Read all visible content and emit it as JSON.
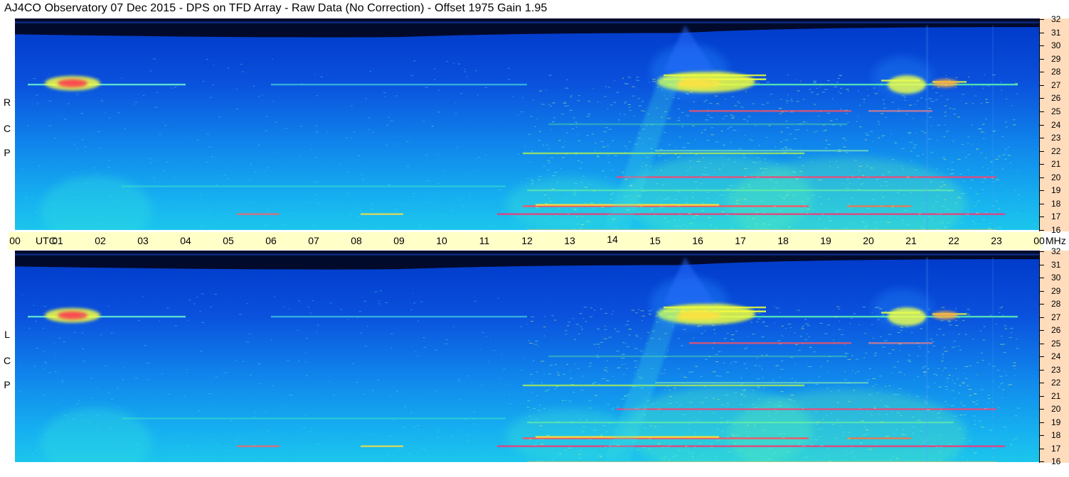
{
  "title": "AJ4CO Observatory  07 Dec 2015  -  DPS on TFD Array  -  Raw Data (No Correction)  -  Offset 1975  Gain 1.95",
  "colors": {
    "timebar": "#ffffc8",
    "freqscale": "#ffdcbc",
    "low": "#0a2db4",
    "high": "#ff3040"
  },
  "chart_data": [
    {
      "type": "heatmap",
      "panel": "RCP",
      "side_label": [
        "R",
        "C",
        "P"
      ],
      "x_unit": "UTC",
      "x_ticks": [
        "00",
        "01",
        "02",
        "03",
        "04",
        "05",
        "06",
        "07",
        "08",
        "09",
        "10",
        "11",
        "12",
        "13",
        "14",
        "15",
        "16",
        "17",
        "18",
        "19",
        "20",
        "21",
        "22",
        "23",
        "00"
      ],
      "xlim": [
        0,
        24
      ],
      "y_unit": "MHz",
      "y_ticks": [
        32,
        31,
        30,
        29,
        28,
        27,
        26,
        25,
        24,
        23,
        22,
        21,
        20,
        19,
        18,
        17,
        16
      ],
      "ylim": [
        16,
        32
      ]
    },
    {
      "type": "heatmap",
      "panel": "LCP",
      "side_label": [
        "L",
        "C",
        "P"
      ],
      "x_unit": "UTC",
      "x_ticks": [
        "00",
        "01",
        "02",
        "03",
        "04",
        "05",
        "06",
        "07",
        "08",
        "09",
        "10",
        "11",
        "12",
        "13",
        "14",
        "15",
        "16",
        "17",
        "18",
        "19",
        "20",
        "21",
        "22",
        "23",
        "00"
      ],
      "xlim": [
        0,
        24
      ],
      "y_unit": "MHz",
      "y_ticks": [
        32,
        31,
        30,
        29,
        28,
        27,
        26,
        25,
        24,
        23,
        22,
        21,
        20,
        19,
        18,
        17,
        16
      ],
      "ylim": [
        16,
        32
      ]
    }
  ],
  "timebar": {
    "utc_label": "UTC",
    "mhz_label": "MHz",
    "labels": [
      "00",
      "01",
      "02",
      "03",
      "04",
      "05",
      "06",
      "07",
      "08",
      "09",
      "10",
      "11",
      "12",
      "13",
      "14",
      "15",
      "16",
      "17",
      "18",
      "19",
      "20",
      "21",
      "22",
      "23",
      "00"
    ]
  }
}
